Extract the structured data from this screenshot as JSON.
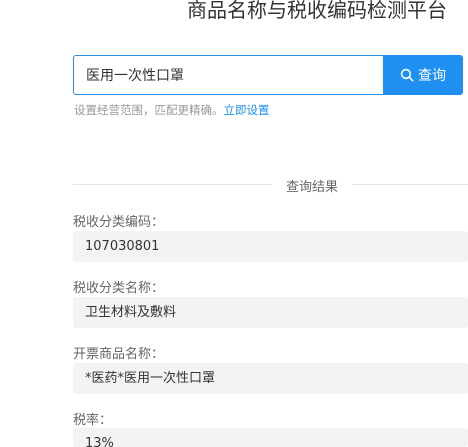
{
  "header": {
    "title": "商品名称与税收编码检测平台"
  },
  "search": {
    "value": "医用一次性口罩",
    "button_label": "查询"
  },
  "hint": {
    "text": "设置经营范围，匹配更精确。",
    "link": "立即设置"
  },
  "results": {
    "title": "查询结果",
    "fields": [
      {
        "label": "税收分类编码：",
        "value": "107030801"
      },
      {
        "label": "税收分类名称：",
        "value": "卫生材料及敷料"
      },
      {
        "label": "开票商品名称：",
        "value": "*医药*医用一次性口罩"
      },
      {
        "label": "税率：",
        "value": "13%"
      }
    ]
  },
  "colors": {
    "accent": "#1f8ff1",
    "field_bg": "#f3f3f3"
  }
}
